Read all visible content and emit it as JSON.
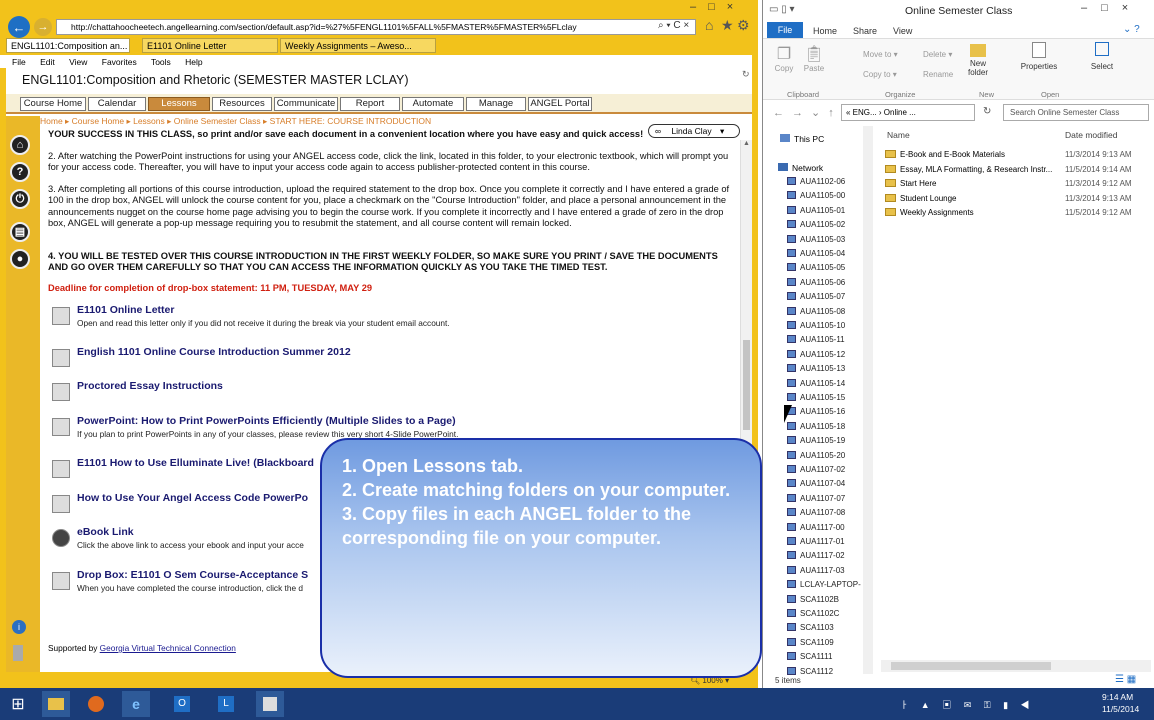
{
  "ie": {
    "address": "http://chattahoocheetech.angellearning.com/section/default.asp?id=%27%5FENGL1101%5FALL%5FMASTER%5FMASTER%5FLclay",
    "tabs": [
      "ENGL1101:Composition an...",
      "E1101 Online Letter",
      "Weekly Assignments – Aweso..."
    ],
    "menu": [
      "File",
      "Edit",
      "View",
      "Favorites",
      "Tools",
      "Help"
    ],
    "course_title": "ENGL1101:Composition and Rhetoric (SEMESTER MASTER LCLAY)",
    "nav_tabs": [
      "Course Home",
      "Calendar",
      "Lessons",
      "Resources",
      "Communicate",
      "Report",
      "Automate",
      "Manage",
      "ANGEL Portal"
    ],
    "breadcrumb": "Home ▸ Course Home ▸ Lessons ▸ Online Semester Class ▸ START HERE: COURSE INTRODUCTION",
    "user_name": "Linda Clay",
    "para_top": "YOUR SUCCESS IN THIS CLASS, so print and/or save each document in a convenient location where you have easy and quick access!",
    "para2": "2. After watching the PowerPoint instructions for using your ANGEL access code, click the link, located in this folder, to your electronic textbook, which will prompt you for your access code. Thereafter, you will have to input your access code again to access publisher-protected content in this course.",
    "para3": "3. After completing all portions of this course introduction, upload the required statement to the drop box. Once you complete it correctly and I have entered a grade of 100 in the drop box, ANGEL will unlock the course content for you, place a checkmark on the \"Course Introduction\" folder, and place a personal announcement in the announcements nugget on the course home page advising you to begin the course work. If you complete it incorrectly and I have entered a grade of zero in the drop box, ANGEL will generate a pop-up message requiring you to resubmit the statement, and all course content will remain locked.",
    "para4": "4. YOU WILL BE TESTED OVER THIS COURSE INTRODUCTION IN THE FIRST WEEKLY FOLDER, SO MAKE SURE YOU PRINT / SAVE THE DOCUMENTS AND GO OVER THEM CAREFULLY SO THAT YOU CAN ACCESS THE INFORMATION QUICKLY AS YOU TAKE THE TIMED TEST.",
    "deadline": "Deadline for completion of drop-box statement: 11 PM, TUESDAY, MAY 29",
    "items": [
      {
        "title": "E1101 Online Letter",
        "sub": "Open and read this letter only if you did not receive it during the break via your student email account."
      },
      {
        "title": "English 1101 Online Course Introduction Summer 2012",
        "sub": ""
      },
      {
        "title": "Proctored Essay Instructions",
        "sub": ""
      },
      {
        "title": "PowerPoint: How to Print PowerPoints Efficiently (Multiple Slides to a Page)",
        "sub": "If you plan to print PowerPoints in any of your classes, please review this very short 4-Slide PowerPoint."
      },
      {
        "title": "E1101 How to Use Elluminate Live! (Blackboard",
        "sub": ""
      },
      {
        "title": "How to Use Your Angel Access Code PowerPo",
        "sub": ""
      },
      {
        "title": "eBook Link",
        "sub": "Click the above link to access your ebook and input your acce"
      },
      {
        "title": "Drop Box: E1101 O Sem Course-Acceptance S",
        "sub": "When you have completed the course introduction, click the d"
      }
    ],
    "footer_prefix": "Supported by ",
    "footer_link": "Georgia Virtual Technical Connection",
    "zoom": "100%"
  },
  "callout": {
    "lines": [
      "1. Open Lessons tab.",
      "2. Create matching folders on your computer.",
      "3. Copy files in each ANGEL folder to the corresponding file on your computer."
    ]
  },
  "explorer": {
    "title": "Online Semester Class",
    "ribbon_tabs": [
      "File",
      "Home",
      "Share",
      "View"
    ],
    "ribbon": {
      "copy": "Copy",
      "paste": "Paste",
      "move_to": "Move to ▾",
      "copy_to": "Copy to ▾",
      "delete": "Delete ▾",
      "rename": "Rename",
      "new_folder": "New folder",
      "properties": "Properties",
      "select": "Select",
      "grp_clipboard": "Clipboard",
      "grp_organize": "Organize",
      "grp_new": "New",
      "grp_open": "Open"
    },
    "path": "«  ENG...  ›  Online ...",
    "search_placeholder": "Search Online Semester Class",
    "tree_this_pc": "This PC",
    "tree_network": "Network",
    "tree_items": [
      "AUA1102-06",
      "AUA1105-00",
      "AUA1105-01",
      "AUA1105-02",
      "AUA1105-03",
      "AUA1105-04",
      "AUA1105-05",
      "AUA1105-06",
      "AUA1105-07",
      "AUA1105-08",
      "AUA1105-10",
      "AUA1105-11",
      "AUA1105-12",
      "AUA1105-13",
      "AUA1105-14",
      "AUA1105-15",
      "AUA1105-16",
      "AUA1105-18",
      "AUA1105-19",
      "AUA1105-20",
      "AUA1107-02",
      "AUA1107-04",
      "AUA1107-07",
      "AUA1107-08",
      "AUA1117-00",
      "AUA1117-01",
      "AUA1117-02",
      "AUA1117-03",
      "LCLAY-LAPTOP-",
      "SCA1102B",
      "SCA1102C",
      "SCA1103",
      "SCA1109",
      "SCA1111",
      "SCA1112"
    ],
    "col_name": "Name",
    "col_date": "Date modified",
    "files": [
      {
        "name": "E-Book and E-Book Materials",
        "date": "11/3/2014 9:13 AM"
      },
      {
        "name": "Essay, MLA Formatting, & Research Instr...",
        "date": "11/5/2014 9:14 AM"
      },
      {
        "name": "Start Here",
        "date": "11/3/2014 9:12 AM"
      },
      {
        "name": "Student Lounge",
        "date": "11/3/2014 9:13 AM"
      },
      {
        "name": "Weekly Assignments",
        "date": "11/5/2014 9:12 AM"
      }
    ],
    "status": "5 items"
  },
  "taskbar": {
    "time": "9:14 AM",
    "date": "11/5/2014"
  }
}
